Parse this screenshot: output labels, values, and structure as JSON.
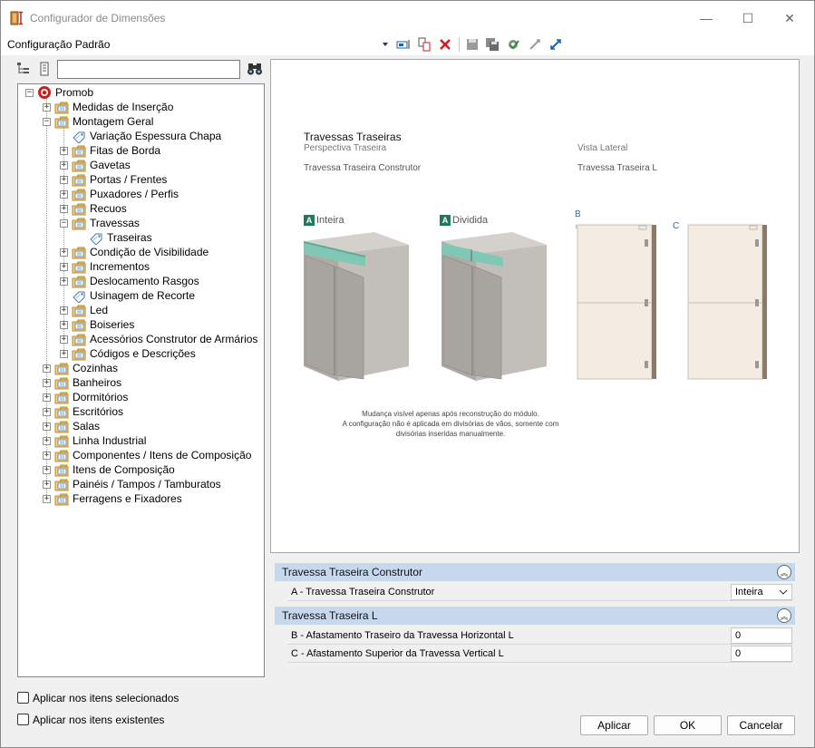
{
  "window": {
    "title": "Configurador de Dimensões",
    "minimize": "—",
    "maximize": "☐",
    "close": "✕"
  },
  "toolbar": {
    "config_name": "Configuração Padrão"
  },
  "search": {
    "value": "",
    "placeholder": ""
  },
  "tree": {
    "root": "Promob",
    "items": [
      {
        "label": "Medidas de Inserção",
        "level": 1,
        "type": "folder",
        "expander": "+"
      },
      {
        "label": "Montagem Geral",
        "level": 1,
        "type": "folder",
        "expander": "−"
      },
      {
        "label": "Variação Espessura Chapa",
        "level": 2,
        "type": "tag",
        "expander": ""
      },
      {
        "label": "Fitas de Borda",
        "level": 2,
        "type": "folder",
        "expander": "+"
      },
      {
        "label": "Gavetas",
        "level": 2,
        "type": "folder",
        "expander": "+"
      },
      {
        "label": "Portas / Frentes",
        "level": 2,
        "type": "folder",
        "expander": "+"
      },
      {
        "label": "Puxadores / Perfis",
        "level": 2,
        "type": "folder",
        "expander": "+"
      },
      {
        "label": "Recuos",
        "level": 2,
        "type": "folder",
        "expander": "+"
      },
      {
        "label": "Travessas",
        "level": 2,
        "type": "folder",
        "expander": "−"
      },
      {
        "label": "Traseiras",
        "level": 3,
        "type": "tag",
        "expander": "",
        "selected": true
      },
      {
        "label": "Condição de Visibilidade",
        "level": 2,
        "type": "folder",
        "expander": "+"
      },
      {
        "label": "Incrementos",
        "level": 2,
        "type": "folder",
        "expander": "+"
      },
      {
        "label": "Deslocamento Rasgos",
        "level": 2,
        "type": "folder",
        "expander": "+"
      },
      {
        "label": "Usinagem de Recorte",
        "level": 2,
        "type": "tag",
        "expander": ""
      },
      {
        "label": "Led",
        "level": 2,
        "type": "folder",
        "expander": "+"
      },
      {
        "label": "Boiseries",
        "level": 2,
        "type": "folder",
        "expander": "+"
      },
      {
        "label": "Acessórios Construtor de Armários",
        "level": 2,
        "type": "folder",
        "expander": "+"
      },
      {
        "label": "Códigos e Descrições",
        "level": 2,
        "type": "folder",
        "expander": "+"
      },
      {
        "label": "Cozinhas",
        "level": 1,
        "type": "folder",
        "expander": "+"
      },
      {
        "label": "Banheiros",
        "level": 1,
        "type": "folder",
        "expander": "+"
      },
      {
        "label": "Dormitórios",
        "level": 1,
        "type": "folder",
        "expander": "+"
      },
      {
        "label": "Escritórios",
        "level": 1,
        "type": "folder",
        "expander": "+"
      },
      {
        "label": "Salas",
        "level": 1,
        "type": "folder",
        "expander": "+"
      },
      {
        "label": "Linha Industrial",
        "level": 1,
        "type": "folder",
        "expander": "+"
      },
      {
        "label": "Componentes / Itens de Composição",
        "level": 1,
        "type": "folder",
        "expander": "+"
      },
      {
        "label": "Itens de Composição",
        "level": 1,
        "type": "folder",
        "expander": "+"
      },
      {
        "label": "Painéis / Tampos / Tamburatos",
        "level": 1,
        "type": "folder",
        "expander": "+"
      },
      {
        "label": "Ferragens e Fixadores",
        "level": 1,
        "type": "folder",
        "expander": "+"
      }
    ]
  },
  "preview": {
    "title": "Travessas Traseiras",
    "subtitle_left": "Perspectiva Traseira",
    "subtitle_right": "Vista Lateral",
    "caption_left": "Travessa Traseira Construtor",
    "caption_right": "Travessa Traseira L",
    "badge_a": "A",
    "label_inteira": "Inteira",
    "label_dividida": "Dividida",
    "marker_b": "B",
    "marker_c": "C",
    "note_line1": "Mudança visível apenas após reconstrução do módulo.",
    "note_line2": "A configuração não é aplicada em divisórias de vãos, somente com",
    "note_line3": "divisórias inseridas manualmente."
  },
  "sections": [
    {
      "title": "Travessa Traseira Construtor",
      "collapse_icon": "︽"
    },
    {
      "title": "Travessa Traseira L",
      "collapse_icon": "︽"
    }
  ],
  "properties": {
    "a_label": "A -  Travessa Traseira Construtor",
    "a_value": "Inteira",
    "b_label": "B - Afastamento Traseiro da Travessa Horizontal L",
    "b_value": "0",
    "c_label": "C - Afastamento Superior da Travessa Vertical L",
    "c_value": "0"
  },
  "options": {
    "apply_selected": "Aplicar nos itens selecionados",
    "apply_existing": "Aplicar nos itens existentes"
  },
  "buttons": {
    "apply": "Aplicar",
    "ok": "OK",
    "cancel": "Cancelar"
  }
}
